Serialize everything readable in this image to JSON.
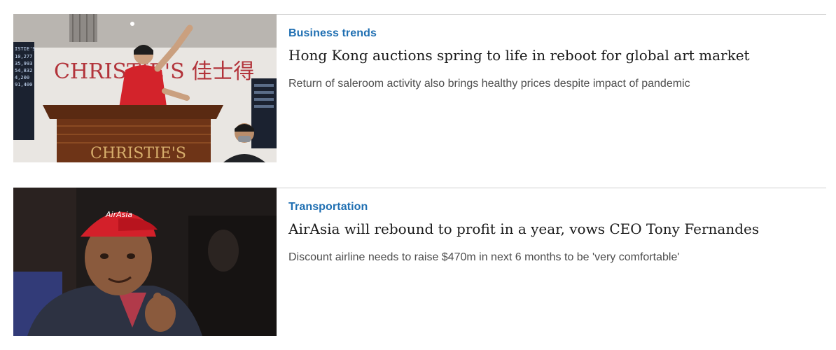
{
  "articles": [
    {
      "category": "Business trends",
      "headline": "Hong Kong auctions spring to life in reboot for global art market",
      "standfirst": "Return of saleroom activity also brings healthy prices despite impact of pandemic",
      "image": {
        "sign_text": "CHRISTIE'S 佳士得",
        "podium_text": "CHRISTIE'S",
        "board_left": [
          "ISTIE'S",
          "10,277",
          "35,993",
          "54,832",
          "4,200",
          "91,400"
        ]
      }
    },
    {
      "category": "Transportation",
      "headline": "AirAsia will rebound to profit in a year, vows CEO Tony Fernandes",
      "standfirst": "Discount airline needs to raise $470m in next 6 months to be 'very comfortable'",
      "image": {
        "cap_text": "AirAsia"
      }
    }
  ],
  "colors": {
    "category": "#1f6fb2",
    "headline": "#1a1a1a",
    "standfirst": "#4d4d4d",
    "rule": "#cfcfcf"
  }
}
